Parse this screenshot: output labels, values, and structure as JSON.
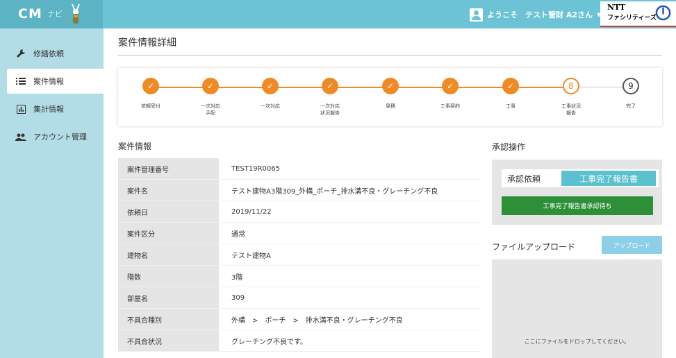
{
  "header": {
    "brand": "CM",
    "brand_sub": "ナビ",
    "user_text": "ようこそ　テスト管財 A2さん",
    "user_caret": "▼",
    "logo_line1": "NTT",
    "logo_line2": "ファシリティーズ",
    "colors": {
      "header_bg": "#6cc3d6",
      "brand_bg": "#5bb3c4",
      "logo_accent": "#d63a2f",
      "power_icon": "#1e4fb8"
    }
  },
  "sidebar": {
    "items": [
      {
        "label": "修繕依頼",
        "icon": "wrench-icon",
        "active": false
      },
      {
        "label": "案件情報",
        "icon": "list-icon",
        "active": true
      },
      {
        "label": "集計情報",
        "icon": "bar-chart-icon",
        "active": false
      },
      {
        "label": "アカウント管理",
        "icon": "people-icon",
        "active": false
      }
    ]
  },
  "page": {
    "title": "案件情報詳細"
  },
  "stepper": {
    "accent_color": "#f08a24",
    "steps": [
      {
        "label": "依頼受付",
        "state": "done"
      },
      {
        "label": "一次対応\n手配",
        "state": "done"
      },
      {
        "label": "一次対応",
        "state": "done"
      },
      {
        "label": "一次対応\n状況報告",
        "state": "done"
      },
      {
        "label": "見積",
        "state": "done"
      },
      {
        "label": "工事契約",
        "state": "done"
      },
      {
        "label": "工事",
        "state": "done"
      },
      {
        "label": "工事状況\n報告",
        "state": "current",
        "number": "8"
      },
      {
        "label": "完了",
        "state": "todo",
        "number": "9"
      }
    ],
    "check_mark": "✓"
  },
  "case_info": {
    "section_title": "案件情報",
    "rows": [
      {
        "label": "案件管理番号",
        "value": "TEST19R0065"
      },
      {
        "label": "案件名",
        "value": "テスト建物A3階309_外構_ポーチ_排水溝不良・グレーチング不良"
      },
      {
        "label": "依頼日",
        "value": "2019/11/22"
      },
      {
        "label": "案件区分",
        "value": "通常"
      },
      {
        "label": "建物名",
        "value": "テスト建物A"
      },
      {
        "label": "階数",
        "value": "3階"
      },
      {
        "label": "部屋名",
        "value": "309"
      },
      {
        "label": "不具合種別",
        "value": "外構　>　ポーチ　>　排水溝不良・グレーチング不良"
      },
      {
        "label": "不具合状況",
        "value": "グレーチング不良です。"
      }
    ]
  },
  "approval": {
    "section_title": "承認操作",
    "request_label": "承認依頼",
    "request_value": "工事完了報告書",
    "button_label": "工事完了報告書承認待ち",
    "colors": {
      "request_bg": "#5bc0cf",
      "button_bg": "#2d8f37"
    }
  },
  "upload": {
    "section_title": "ファイルアップロード",
    "button_label": "アップロード",
    "drop_text": "ここにファイルをドロップしてください。"
  }
}
